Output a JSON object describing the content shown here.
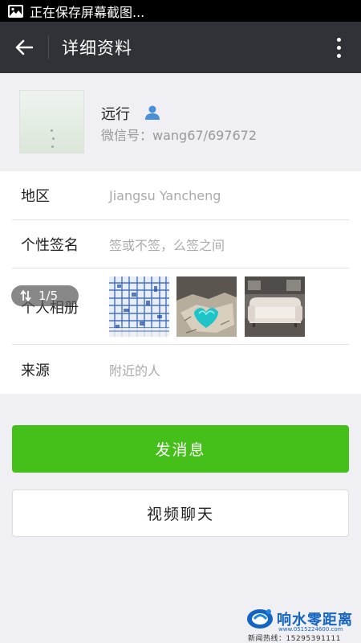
{
  "status_bar": {
    "text": "正在保存屏幕截图..."
  },
  "title_bar": {
    "title": "详细资料"
  },
  "profile": {
    "name": "远行",
    "wechat_id": "微信号：wang67/697672"
  },
  "info": {
    "region_label": "地区",
    "region_value": "Jiangsu  Yancheng",
    "signature_label": "个性签名",
    "signature_value": "签或不签，么签之间",
    "album_label": "个人相册",
    "album_photos": [
      "blue-grid-photo",
      "turquoise-heart-rock-photo",
      "sofa-photo"
    ],
    "source_label": "来源",
    "source_value": "附近的人"
  },
  "badge": {
    "text": "1/5"
  },
  "buttons": {
    "send": "发消息",
    "video": "视频聊天"
  },
  "watermark": {
    "title": "响水零距离",
    "url": "www.0515224600.com",
    "hotline": "新闻热线：15295391111"
  },
  "colors": {
    "title_bar": "#2f3337",
    "send_button": "#45c01a",
    "background": "#efeff4"
  }
}
